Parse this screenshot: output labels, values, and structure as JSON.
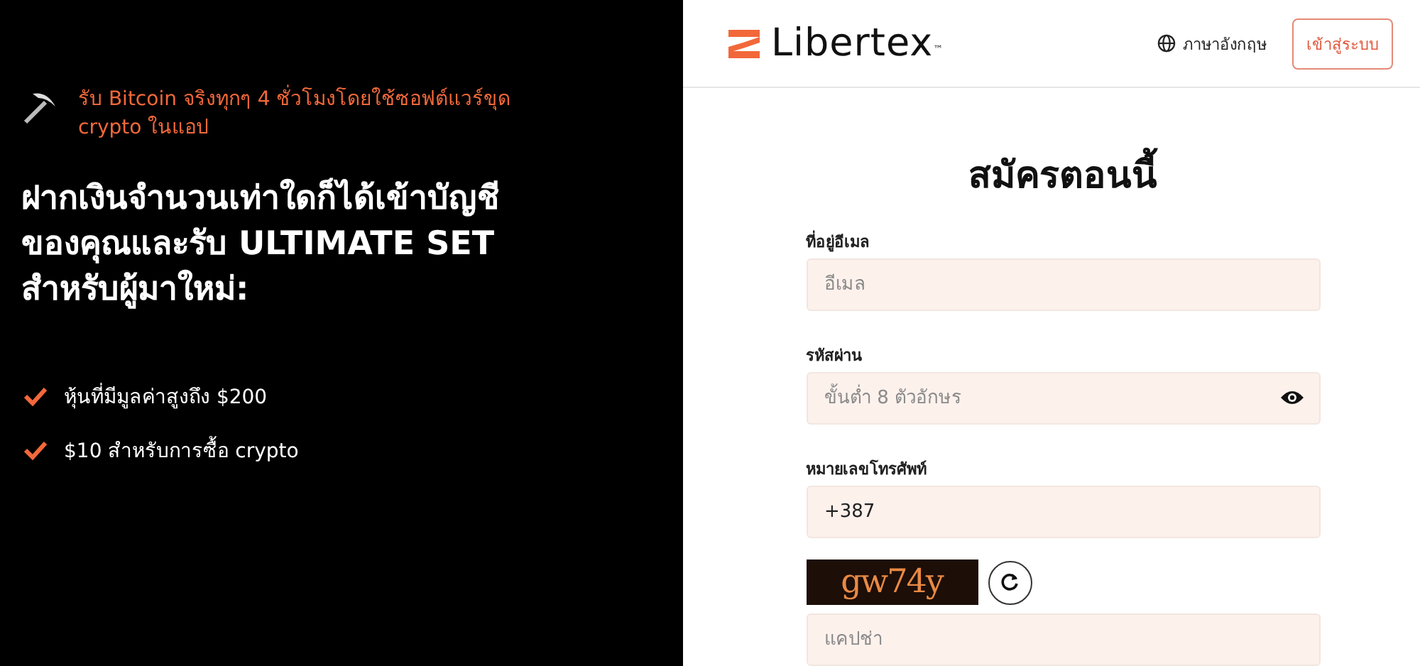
{
  "promo": {
    "banner": "รับ Bitcoin จริงทุกๆ 4 ชั่วโมงโดยใช้ซอฟต์แวร์ขุด crypto ในแอป",
    "headline": "ฝากเงินจำนวนเท่าใดก็ได้เข้าบัญชีของคุณและรับ ULTIMATE SET สำหรับผู้มาใหม่:",
    "benefits": [
      "หุ้นที่มีมูลค่าสูงถึง $200",
      "$10 สำหรับการซื้อ crypto"
    ]
  },
  "header": {
    "logo": "Libertex",
    "trademark": "™",
    "language": "ภาษาอังกฤษ",
    "login": "เข้าสู่ระบบ"
  },
  "form": {
    "title": "สมัครตอนนี้",
    "fields": [
      {
        "label": "ที่อยู่อีเมล",
        "placeholder": "อีเมล",
        "kind": "text"
      },
      {
        "label": "รหัสผ่าน",
        "placeholder": "ขั้นต่ำ 8 ตัวอักษร",
        "kind": "password"
      },
      {
        "label": "หมายเลขโทรศัพท์",
        "value": "+387",
        "kind": "text"
      }
    ],
    "captcha": {
      "text": "gw74y",
      "placeholder": "แคปช่า"
    }
  }
}
